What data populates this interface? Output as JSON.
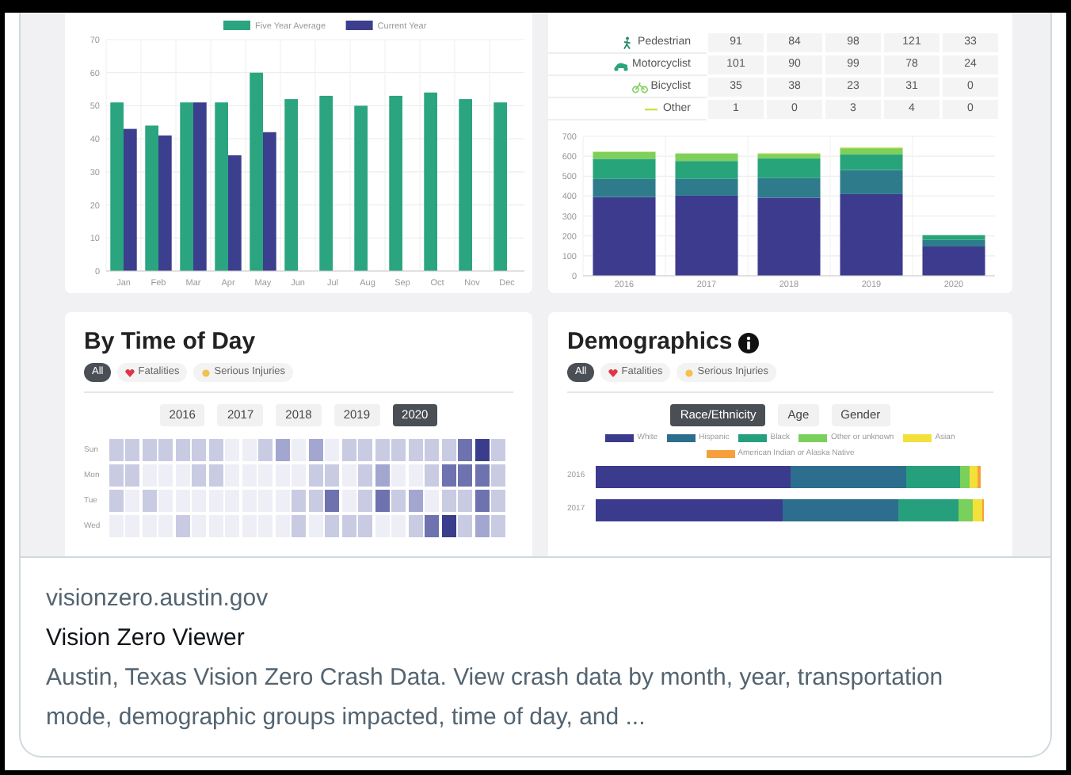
{
  "preview_image": {
    "monthly_panel": {
      "chart_data": {
        "type": "bar",
        "categories": [
          "Jan",
          "Feb",
          "Mar",
          "Apr",
          "May",
          "Jun",
          "Jul",
          "Aug",
          "Sep",
          "Oct",
          "Nov",
          "Dec"
        ],
        "series": [
          {
            "name": "Five Year Average",
            "color": "#2aa57f",
            "values": [
              51,
              44,
              51,
              51,
              60,
              52,
              53,
              50,
              53,
              54,
              52,
              51
            ]
          },
          {
            "name": "Current Year",
            "color": "#3c3f8d",
            "values": [
              43,
              41,
              51,
              35,
              42,
              null,
              null,
              null,
              null,
              null,
              null,
              null
            ]
          }
        ],
        "ylim": [
          0,
          70
        ],
        "yticks": [
          0,
          10,
          20,
          30,
          40,
          50,
          60,
          70
        ],
        "grid": true,
        "legend": "top"
      }
    },
    "mode_panel": {
      "table": {
        "rows": [
          {
            "mode": "Pedestrian",
            "kind": "pedestrian",
            "values": [
              "91",
              "84",
              "98",
              "121",
              "33"
            ]
          },
          {
            "mode": "Motorcyclist",
            "kind": "motorcyclist",
            "values": [
              "101",
              "90",
              "99",
              "78",
              "24"
            ]
          },
          {
            "mode": "Bicyclist",
            "kind": "bicyclist",
            "values": [
              "35",
              "38",
              "23",
              "31",
              "0"
            ]
          },
          {
            "mode": "Other",
            "kind": "other",
            "values": [
              "1",
              "0",
              "3",
              "4",
              "0"
            ]
          }
        ]
      },
      "chart_data": {
        "type": "bar",
        "stacked": true,
        "categories": [
          "2016",
          "2017",
          "2018",
          "2019",
          "2020"
        ],
        "series": [
          {
            "color": "#3d3b8e",
            "values": [
              395,
              402,
              392,
              410,
              147
            ]
          },
          {
            "color": "#2e7b8c",
            "values": [
              91,
              84,
              98,
              121,
              33
            ]
          },
          {
            "color": "#28a47b",
            "values": [
              101,
              90,
              99,
              78,
              24
            ]
          },
          {
            "color": "#7fd05a",
            "values": [
              35,
              38,
              23,
              31,
              0
            ]
          },
          {
            "color": "#cde24f",
            "values": [
              1,
              0,
              3,
              4,
              0
            ]
          }
        ],
        "ylim": [
          0,
          700
        ],
        "yticks": [
          0,
          100,
          200,
          300,
          400,
          500,
          600,
          700
        ],
        "grid": true
      }
    },
    "time_panel": {
      "title": "By Time of Day",
      "filters": [
        {
          "label": "All",
          "kind": "all",
          "selected": true
        },
        {
          "label": "Fatalities",
          "kind": "fatalities",
          "selected": false
        },
        {
          "label": "Serious Injuries",
          "kind": "injuries",
          "selected": false
        }
      ],
      "years": [
        {
          "label": "2016",
          "selected": false
        },
        {
          "label": "2017",
          "selected": false
        },
        {
          "label": "2018",
          "selected": false
        },
        {
          "label": "2019",
          "selected": false
        },
        {
          "label": "2020",
          "selected": true
        }
      ],
      "heatmap_rows": [
        "Sun",
        "Mon",
        "Tue",
        "Wed"
      ]
    },
    "demographics_panel": {
      "title": "Demographics",
      "filters": [
        {
          "label": "All",
          "kind": "all",
          "selected": true
        },
        {
          "label": "Fatalities",
          "kind": "fatalities",
          "selected": false
        },
        {
          "label": "Serious Injuries",
          "kind": "injuries",
          "selected": false
        }
      ],
      "tabs": [
        {
          "label": "Race/Ethnicity",
          "selected": true
        },
        {
          "label": "Age",
          "selected": false
        },
        {
          "label": "Gender",
          "selected": false
        }
      ],
      "legend": [
        {
          "label": "White",
          "color": "#3b3b8e"
        },
        {
          "label": "Hispanic",
          "color": "#2d6e8e"
        },
        {
          "label": "Black",
          "color": "#26a07c"
        },
        {
          "label": "Other or unknown",
          "color": "#79d05b"
        },
        {
          "label": "Asian",
          "color": "#f3e03a"
        },
        {
          "label": "American Indian or Alaska Native",
          "color": "#f5a03a"
        }
      ],
      "bar_rows": [
        "2016",
        "2017"
      ]
    }
  },
  "link": {
    "domain": "visionzero.austin.gov",
    "title": "Vision Zero Viewer",
    "description": "Austin, Texas Vision Zero Crash Data. View crash data by month, year, transportation mode, demographic groups impacted, time of day, and ..."
  }
}
